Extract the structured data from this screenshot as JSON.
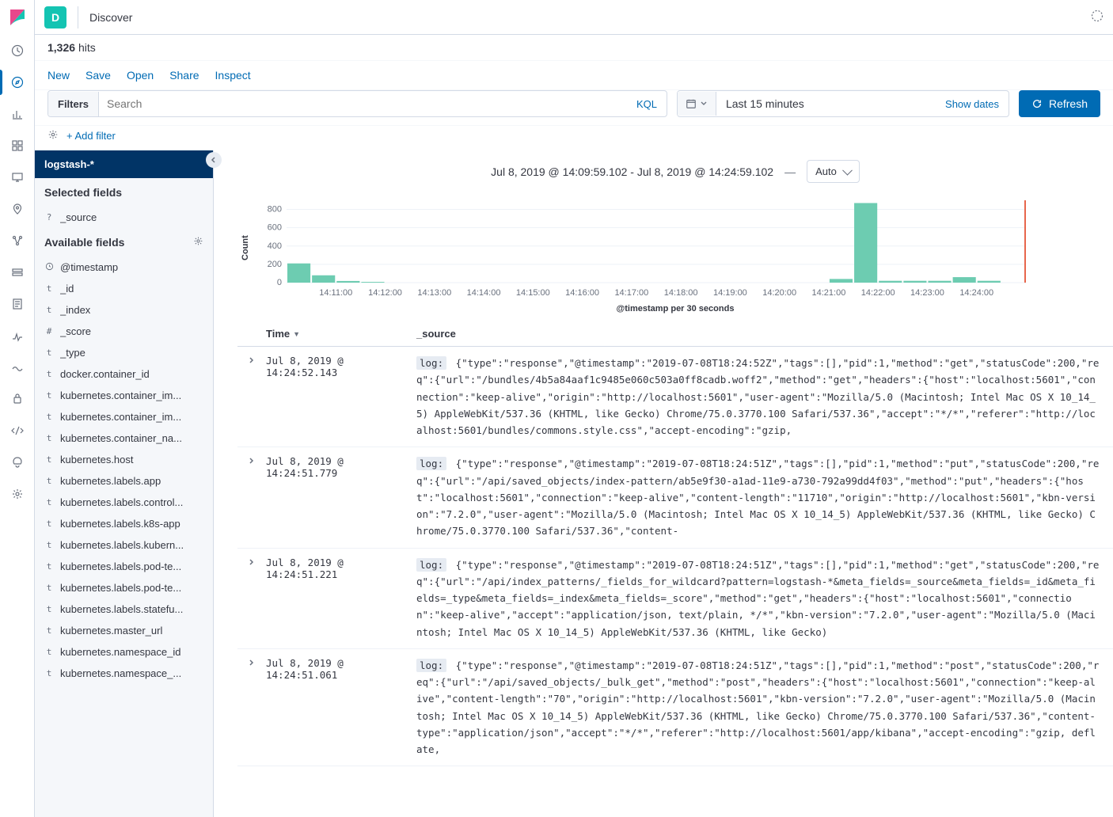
{
  "header": {
    "app_initial": "D",
    "app_title": "Discover"
  },
  "hits": {
    "count": "1,326",
    "label": "hits"
  },
  "toolbar": {
    "new": "New",
    "save": "Save",
    "open": "Open",
    "share": "Share",
    "inspect": "Inspect"
  },
  "filter": {
    "label": "Filters",
    "placeholder": "Search",
    "kql": "KQL"
  },
  "date": {
    "range": "Last 15 minutes",
    "show": "Show dates"
  },
  "refresh": "Refresh",
  "addfilter": "+ Add filter",
  "sidebar": {
    "index": "logstash-*",
    "selected_title": "Selected fields",
    "selected": [
      {
        "type": "?",
        "name": "_source"
      }
    ],
    "available_title": "Available fields",
    "available": [
      {
        "type": "clock",
        "name": "@timestamp"
      },
      {
        "type": "t",
        "name": "_id"
      },
      {
        "type": "t",
        "name": "_index"
      },
      {
        "type": "#",
        "name": "_score"
      },
      {
        "type": "t",
        "name": "_type"
      },
      {
        "type": "t",
        "name": "docker.container_id"
      },
      {
        "type": "t",
        "name": "kubernetes.container_im..."
      },
      {
        "type": "t",
        "name": "kubernetes.container_im..."
      },
      {
        "type": "t",
        "name": "kubernetes.container_na..."
      },
      {
        "type": "t",
        "name": "kubernetes.host"
      },
      {
        "type": "t",
        "name": "kubernetes.labels.app"
      },
      {
        "type": "t",
        "name": "kubernetes.labels.control..."
      },
      {
        "type": "t",
        "name": "kubernetes.labels.k8s-app"
      },
      {
        "type": "t",
        "name": "kubernetes.labels.kubern..."
      },
      {
        "type": "t",
        "name": "kubernetes.labels.pod-te..."
      },
      {
        "type": "t",
        "name": "kubernetes.labels.pod-te..."
      },
      {
        "type": "t",
        "name": "kubernetes.labels.statefu..."
      },
      {
        "type": "t",
        "name": "kubernetes.master_url"
      },
      {
        "type": "t",
        "name": "kubernetes.namespace_id"
      },
      {
        "type": "t",
        "name": "kubernetes.namespace_..."
      }
    ]
  },
  "chart_header": {
    "range_text": "Jul 8, 2019 @ 14:09:59.102 - Jul 8, 2019 @ 14:24:59.102",
    "dash": "—",
    "interval": "Auto"
  },
  "chart_data": {
    "type": "bar",
    "ylabel": "Count",
    "xlabel": "@timestamp per 30 seconds",
    "yticks": [
      0,
      200,
      400,
      600,
      800
    ],
    "ylim": [
      0,
      900
    ],
    "xticks": [
      "14:11:00",
      "14:12:00",
      "14:13:00",
      "14:14:00",
      "14:15:00",
      "14:16:00",
      "14:17:00",
      "14:18:00",
      "14:19:00",
      "14:20:00",
      "14:21:00",
      "14:22:00",
      "14:23:00",
      "14:24:00"
    ],
    "bars": [
      {
        "x": 0,
        "value": 210
      },
      {
        "x": 1,
        "value": 80
      },
      {
        "x": 2,
        "value": 18
      },
      {
        "x": 3,
        "value": 8
      },
      {
        "x": 22,
        "value": 40
      },
      {
        "x": 23,
        "value": 870
      },
      {
        "x": 24,
        "value": 20
      },
      {
        "x": 25,
        "value": 20
      },
      {
        "x": 26,
        "value": 20
      },
      {
        "x": 27,
        "value": 60
      },
      {
        "x": 28,
        "value": 20
      }
    ],
    "bar_slots": 30
  },
  "table": {
    "col_time": "Time",
    "col_source": "_source",
    "rows": [
      {
        "time": "Jul 8, 2019 @ 14:24:52.143",
        "source": "{\"type\":\"response\",\"@timestamp\":\"2019-07-08T18:24:52Z\",\"tags\":[],\"pid\":1,\"method\":\"get\",\"statusCode\":200,\"req\":{\"url\":\"/bundles/4b5a84aaf1c9485e060c503a0ff8cadb.woff2\",\"method\":\"get\",\"headers\":{\"host\":\"localhost:5601\",\"connection\":\"keep-alive\",\"origin\":\"http://localhost:5601\",\"user-agent\":\"Mozilla/5.0 (Macintosh; Intel Mac OS X 10_14_5) AppleWebKit/537.36 (KHTML, like Gecko) Chrome/75.0.3770.100 Safari/537.36\",\"accept\":\"*/*\",\"referer\":\"http://localhost:5601/bundles/commons.style.css\",\"accept-encoding\":\"gzip,"
      },
      {
        "time": "Jul 8, 2019 @ 14:24:51.779",
        "source": "{\"type\":\"response\",\"@timestamp\":\"2019-07-08T18:24:51Z\",\"tags\":[],\"pid\":1,\"method\":\"put\",\"statusCode\":200,\"req\":{\"url\":\"/api/saved_objects/index-pattern/ab5e9f30-a1ad-11e9-a730-792a99dd4f03\",\"method\":\"put\",\"headers\":{\"host\":\"localhost:5601\",\"connection\":\"keep-alive\",\"content-length\":\"11710\",\"origin\":\"http://localhost:5601\",\"kbn-version\":\"7.2.0\",\"user-agent\":\"Mozilla/5.0 (Macintosh; Intel Mac OS X 10_14_5) AppleWebKit/537.36 (KHTML, like Gecko) Chrome/75.0.3770.100 Safari/537.36\",\"content-"
      },
      {
        "time": "Jul 8, 2019 @ 14:24:51.221",
        "source": "{\"type\":\"response\",\"@timestamp\":\"2019-07-08T18:24:51Z\",\"tags\":[],\"pid\":1,\"method\":\"get\",\"statusCode\":200,\"req\":{\"url\":\"/api/index_patterns/_fields_for_wildcard?pattern=logstash-*&meta_fields=_source&meta_fields=_id&meta_fields=_type&meta_fields=_index&meta_fields=_score\",\"method\":\"get\",\"headers\":{\"host\":\"localhost:5601\",\"connection\":\"keep-alive\",\"accept\":\"application/json, text/plain, */*\",\"kbn-version\":\"7.2.0\",\"user-agent\":\"Mozilla/5.0 (Macintosh; Intel Mac OS X 10_14_5) AppleWebKit/537.36 (KHTML, like Gecko)"
      },
      {
        "time": "Jul 8, 2019 @ 14:24:51.061",
        "source": "{\"type\":\"response\",\"@timestamp\":\"2019-07-08T18:24:51Z\",\"tags\":[],\"pid\":1,\"method\":\"post\",\"statusCode\":200,\"req\":{\"url\":\"/api/saved_objects/_bulk_get\",\"method\":\"post\",\"headers\":{\"host\":\"localhost:5601\",\"connection\":\"keep-alive\",\"content-length\":\"70\",\"origin\":\"http://localhost:5601\",\"kbn-version\":\"7.2.0\",\"user-agent\":\"Mozilla/5.0 (Macintosh; Intel Mac OS X 10_14_5) AppleWebKit/537.36 (KHTML, like Gecko) Chrome/75.0.3770.100 Safari/537.36\",\"content-type\":\"application/json\",\"accept\":\"*/*\",\"referer\":\"http://localhost:5601/app/kibana\",\"accept-encoding\":\"gzip, deflate,"
      }
    ]
  },
  "log_tag": "log:"
}
